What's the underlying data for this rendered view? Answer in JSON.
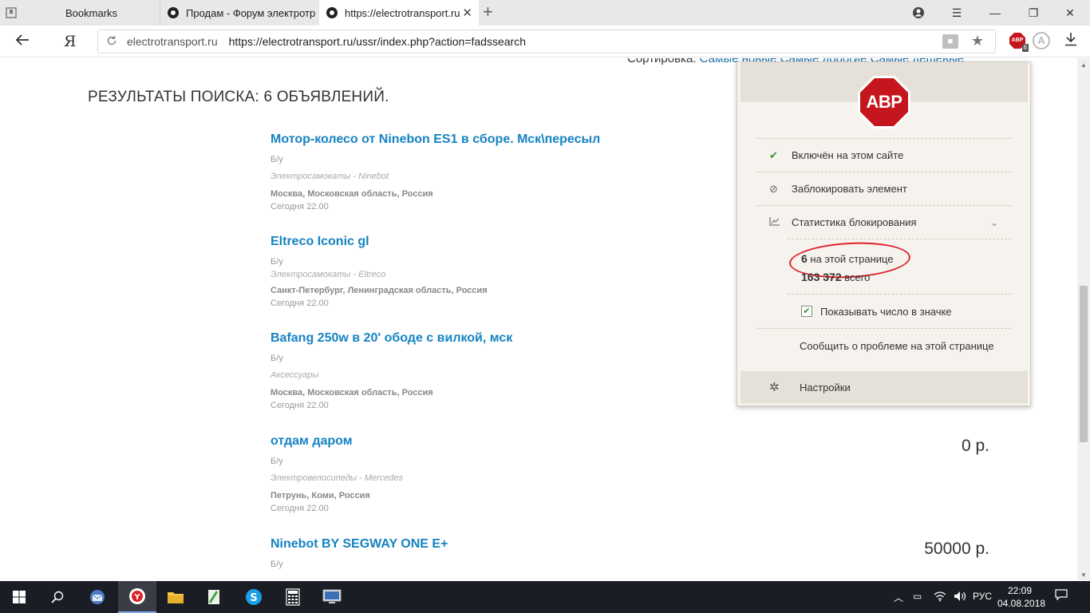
{
  "browser": {
    "tabs": [
      {
        "label": "Bookmarks"
      },
      {
        "label": "Продам - Форум электротр"
      },
      {
        "label": "https://electrotransport.ru"
      }
    ],
    "address": {
      "domain": "electrotransport.ru",
      "url": "https://electrotransport.ru/ussr/index.php?action=fadssearch"
    },
    "yandex_label": "Я",
    "abp_badge_count": "6"
  },
  "page": {
    "sort_prefix": "Сортировка: ",
    "sort_link": "Самые новые Самые дорогие Самые дешевые",
    "results_title": "РЕЗУЛЬТАТЫ ПОИСКА: 6 ОБЪЯВЛЕНИЙ.",
    "listings": [
      {
        "title": "Мотор-колесо от Ninebon ES1 в сборе. Мск\\пересыл",
        "condition": "Б/у",
        "category": "Электросамокаты - Ninebot",
        "location": "Москва, Московская область, Россия",
        "date": "Сегодня 22.00",
        "price": ""
      },
      {
        "title": "Eltreco Iconic gl",
        "condition": "Б/у",
        "category": "Электросамокаты - Eltreco",
        "location": "Санкт-Петербург, Ленинградская область, Россия",
        "date": "Сегодня 22.00",
        "price": ""
      },
      {
        "title": "Bafang 250w в 20' ободе с вилкой, мск",
        "condition": "Б/у",
        "category": "Аксессуары",
        "location": "Москва, Московская область, Россия",
        "date": "Сегодня 22.00",
        "price": ""
      },
      {
        "title": "отдам даром",
        "condition": "Б/у",
        "category": "Электровелосипеды - Mercedes",
        "location": "Петрунь, Коми, Россия",
        "date": "Сегодня 22.00",
        "price": "0 р."
      },
      {
        "title": "Ninebot BY SEGWAY ONE E+",
        "condition": "Б/у",
        "category": "",
        "location": "",
        "date": "",
        "price": "50000 р."
      }
    ]
  },
  "abp": {
    "logo_text": "ABP",
    "enabled_label": "Включён на этом сайте",
    "block_label": "Заблокировать элемент",
    "stats_label": "Статистика блокирования",
    "page_count": "6",
    "page_count_label": " на этой странице",
    "total_count": "163 372",
    "total_count_label": " всего",
    "show_count_label": "Показывать число в значке",
    "show_count_checked": true,
    "report_label": "Сообщить о проблеме на этой странице",
    "settings_label": "Настройки",
    "accent_color": "#c5161d"
  },
  "taskbar": {
    "lang": "РУС",
    "time": "22:09",
    "date": "04.08.2018"
  }
}
